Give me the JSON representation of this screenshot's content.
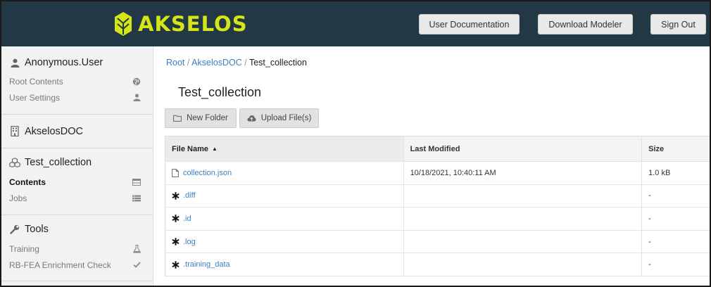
{
  "header": {
    "logo_text": "AKSELOS",
    "logo_color": "#d4e616",
    "buttons": {
      "docs": "User Documentation",
      "download": "Download Modeler",
      "signout": "Sign Out"
    }
  },
  "sidebar": {
    "user": {
      "name": "Anonymous.User",
      "items": [
        {
          "label": "Root Contents",
          "icon": "globe-icon"
        },
        {
          "label": "User Settings",
          "icon": "user-icon"
        }
      ]
    },
    "project": {
      "name": "AkselosDOC",
      "icon": "building-icon"
    },
    "collection": {
      "name": "Test_collection",
      "icon": "cubes-icon",
      "items": [
        {
          "label": "Contents",
          "icon": "table-icon"
        },
        {
          "label": "Jobs",
          "icon": "list-icon"
        }
      ]
    },
    "tools": {
      "name": "Tools",
      "icon": "wrench-icon",
      "items": [
        {
          "label": "Training",
          "icon": "flask-icon"
        },
        {
          "label": "RB-FEA Enrichment Check",
          "icon": "check-icon"
        }
      ]
    }
  },
  "breadcrumb": {
    "root": "Root",
    "sep": "/",
    "parent": "AkselosDOC",
    "current": "Test_collection"
  },
  "main": {
    "title": "Test_collection",
    "new_folder": "New Folder",
    "upload": "Upload File(s)"
  },
  "table": {
    "columns": {
      "name": "File Name",
      "modified": "Last Modified",
      "size": "Size"
    },
    "rows": [
      {
        "name": "collection.json",
        "modified": "10/18/2021, 10:40:11 AM",
        "size": "1.0 kB",
        "icon": "file-icon"
      },
      {
        "name": ".diff",
        "modified": "",
        "size": "-",
        "icon": "asterisk-icon"
      },
      {
        "name": ".id",
        "modified": "",
        "size": "-",
        "icon": "asterisk-icon"
      },
      {
        "name": ".log",
        "modified": "",
        "size": "-",
        "icon": "asterisk-icon"
      },
      {
        "name": ".training_data",
        "modified": "",
        "size": "-",
        "icon": "asterisk-icon"
      }
    ]
  }
}
